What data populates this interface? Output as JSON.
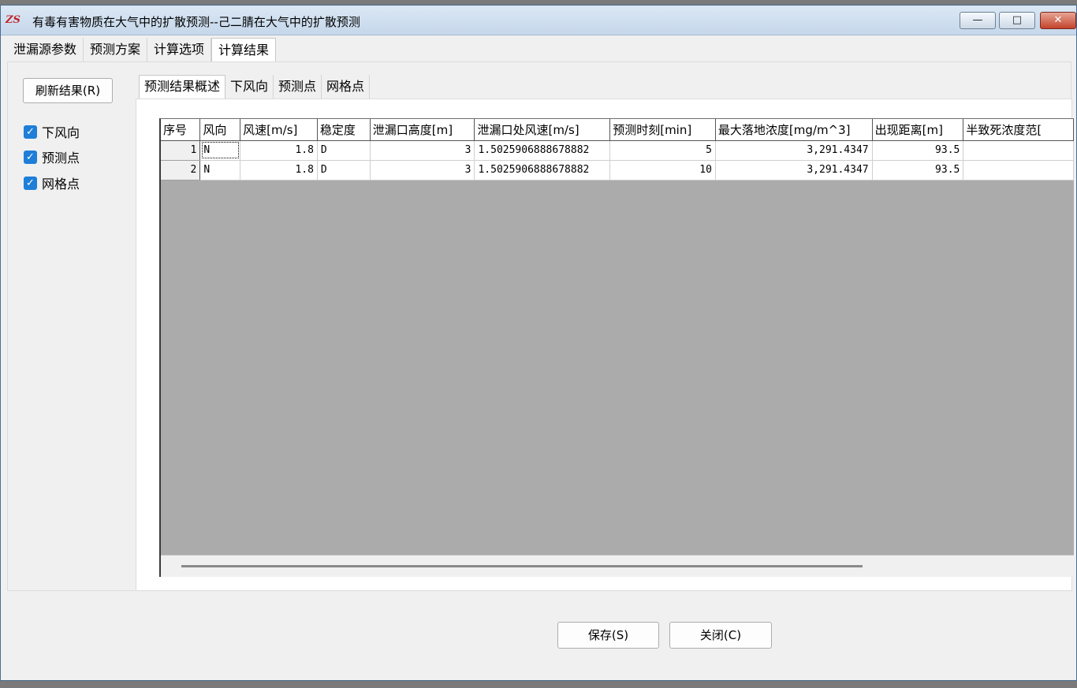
{
  "window": {
    "title": "有毒有害物质在大气中的扩散预测--己二腈在大气中的扩散预测",
    "app_icon_text": "ZS",
    "controls": {
      "minimize": "—",
      "maximize": "□",
      "close": "✕"
    }
  },
  "main_tabs": [
    {
      "label": "泄漏源参数",
      "active": false
    },
    {
      "label": "预测方案",
      "active": false
    },
    {
      "label": "计算选项",
      "active": false
    },
    {
      "label": "计算结果",
      "active": true
    }
  ],
  "sidebar": {
    "refresh_label": "刷新结果(R)",
    "checkboxes": [
      {
        "label": "下风向",
        "checked": true
      },
      {
        "label": "预测点",
        "checked": true
      },
      {
        "label": "网格点",
        "checked": true
      }
    ]
  },
  "sub_tabs": [
    {
      "label": "预测结果概述",
      "active": true
    },
    {
      "label": "下风向",
      "active": false
    },
    {
      "label": "预测点",
      "active": false
    },
    {
      "label": "网格点",
      "active": false
    }
  ],
  "table": {
    "columns": [
      "序号",
      "风向",
      "风速[m/s]",
      "稳定度",
      "泄漏口高度[m]",
      "泄漏口处风速[m/s]",
      "预测时刻[min]",
      "最大落地浓度[mg/m^3]",
      "出现距离[m]",
      "半致死浓度范["
    ],
    "rows": [
      [
        "1",
        "N",
        "1.8",
        "D",
        "3",
        "1.5025906888678882",
        "5",
        "3,291.4347",
        "93.5",
        ""
      ],
      [
        "2",
        "N",
        "1.8",
        "D",
        "3",
        "1.5025906888678882",
        "10",
        "3,291.4347",
        "93.5",
        ""
      ]
    ]
  },
  "buttons": {
    "save": "保存(S)",
    "close": "关闭(C)"
  },
  "icons": {
    "checkbox_check": "check-icon"
  }
}
